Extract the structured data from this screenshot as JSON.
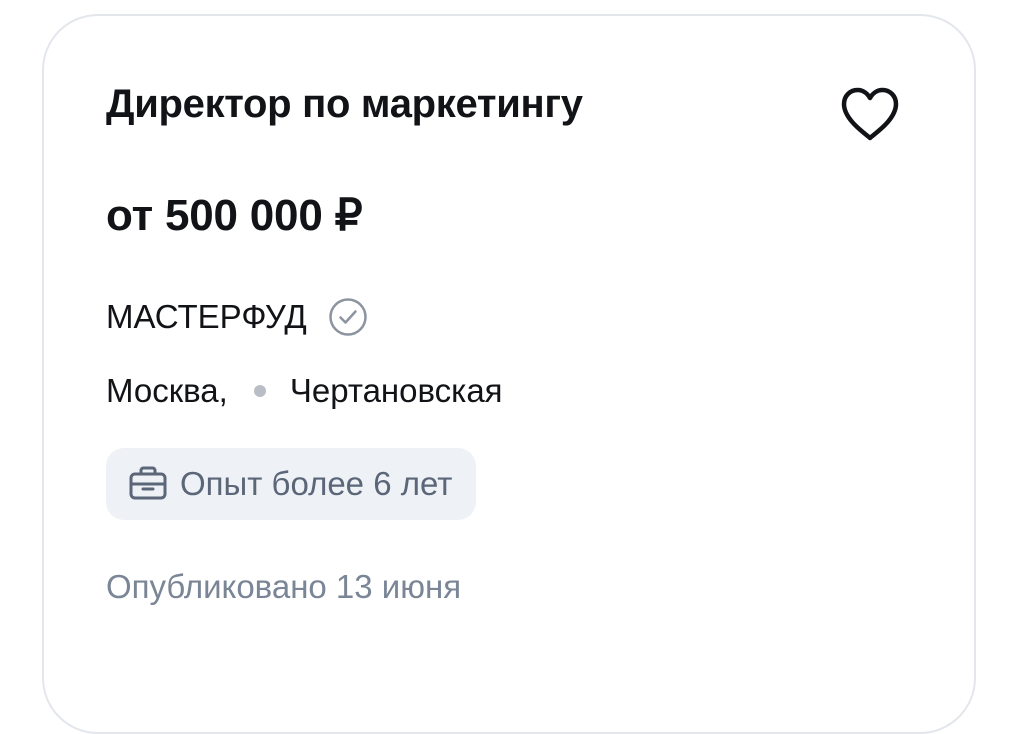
{
  "vacancy": {
    "title": "Директор по маркетингу",
    "salary": "от 500 000 ₽",
    "company": "МАСТЕРФУД",
    "city": "Москва,",
    "metro": "Чертановская",
    "experience": "Опыт более 6 лет",
    "published": "Опубликовано 13 июня"
  },
  "icons": {
    "favorite": "heart-icon",
    "verified": "check-circle-icon",
    "metro": "dot-icon",
    "experience": "briefcase-icon"
  },
  "colors": {
    "text_primary": "#111317",
    "text_secondary": "#5b6678",
    "text_muted": "#7a8596",
    "chip_background": "#eef1f6",
    "card_border": "#e3e7ec",
    "metro_dot": "#b9bec6"
  }
}
